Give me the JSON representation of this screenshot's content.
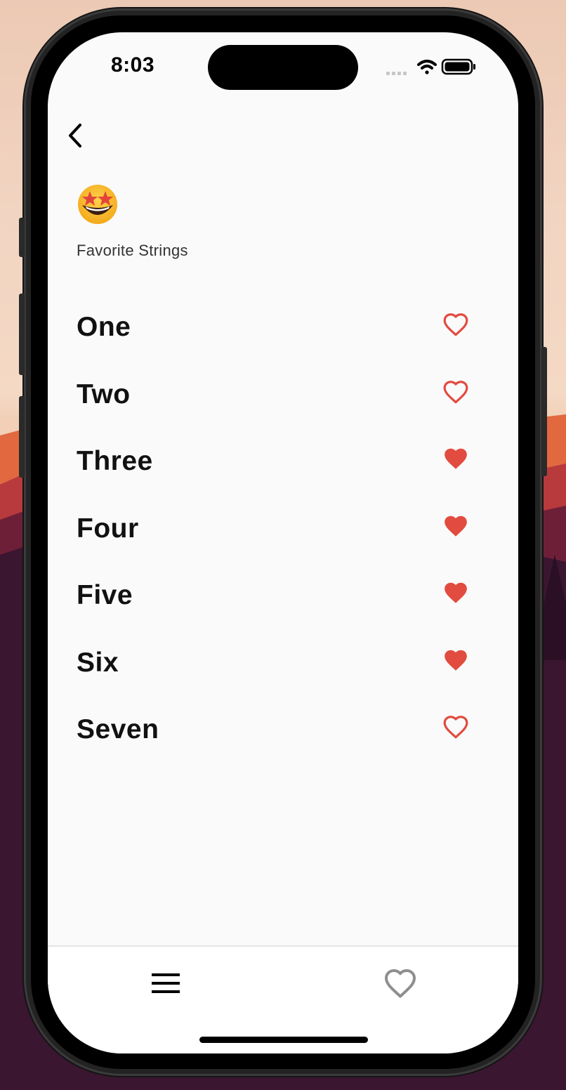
{
  "status_bar": {
    "time": "8:03"
  },
  "header": {
    "back_icon": "chevron-left-icon",
    "emoji": "star-struck",
    "subtitle": "Favorite Strings"
  },
  "items": [
    {
      "label": "One",
      "favorite": false
    },
    {
      "label": "Two",
      "favorite": false
    },
    {
      "label": "Three",
      "favorite": true
    },
    {
      "label": "Four",
      "favorite": true
    },
    {
      "label": "Five",
      "favorite": true
    },
    {
      "label": "Six",
      "favorite": true
    },
    {
      "label": "Seven",
      "favorite": false
    }
  ],
  "bottom_nav": {
    "items": [
      {
        "icon": "menu-icon"
      },
      {
        "icon": "heart-outline-icon"
      }
    ]
  },
  "colors": {
    "accent": "#e24b3f",
    "background": "#fafafa",
    "text": "#111111",
    "nav_icon_inactive": "#8e8e8e"
  }
}
